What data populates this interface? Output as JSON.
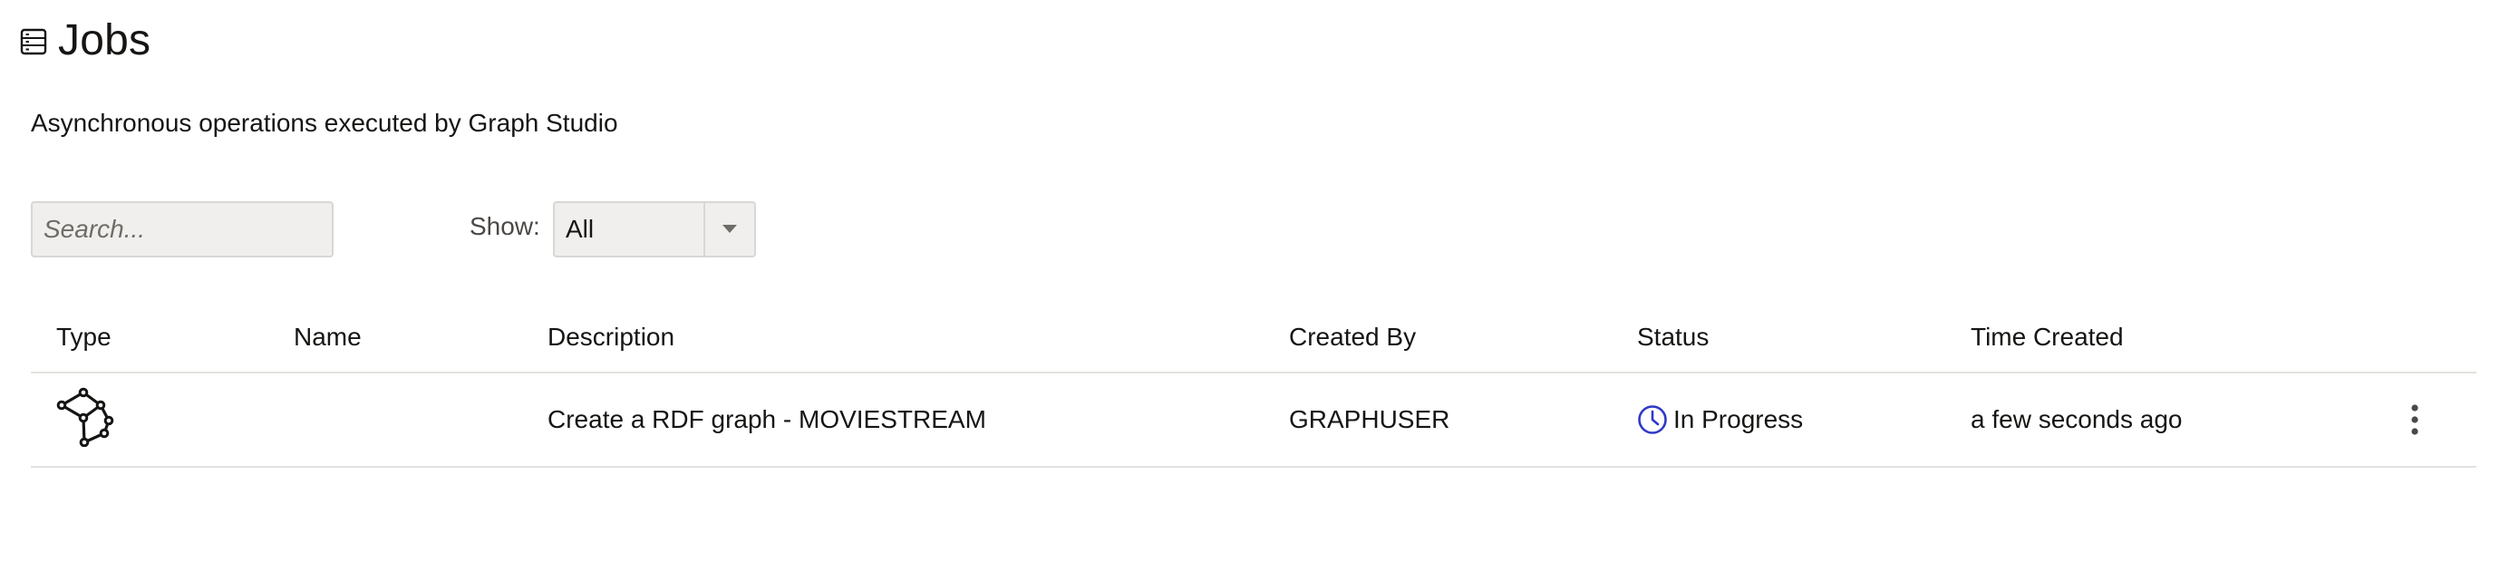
{
  "page": {
    "title": "Jobs",
    "title_icon": "list-icon",
    "subtitle": "Asynchronous operations executed by Graph Studio"
  },
  "toolbar": {
    "search_placeholder": "Search...",
    "show_label": "Show:",
    "show_value": "All",
    "show_dropdown_icon": "caret-down-icon"
  },
  "table": {
    "columns": [
      "Type",
      "Name",
      "Description",
      "Created By",
      "Status",
      "Time Created"
    ],
    "rows": [
      {
        "type_icon": "graph-icon",
        "name": "",
        "description": "Create a RDF graph - MOVIESTREAM",
        "created_by": "GRAPHUSER",
        "status": "In Progress",
        "status_icon": "clock-icon",
        "time_created": "a few seconds ago",
        "actions_icon": "more-vertical-icon"
      }
    ]
  },
  "colors": {
    "text": "#161513",
    "input_bg": "#f1efed",
    "border": "#d9d7d3",
    "divider": "#e4e2df",
    "status_in_progress": "#2f38c7"
  }
}
